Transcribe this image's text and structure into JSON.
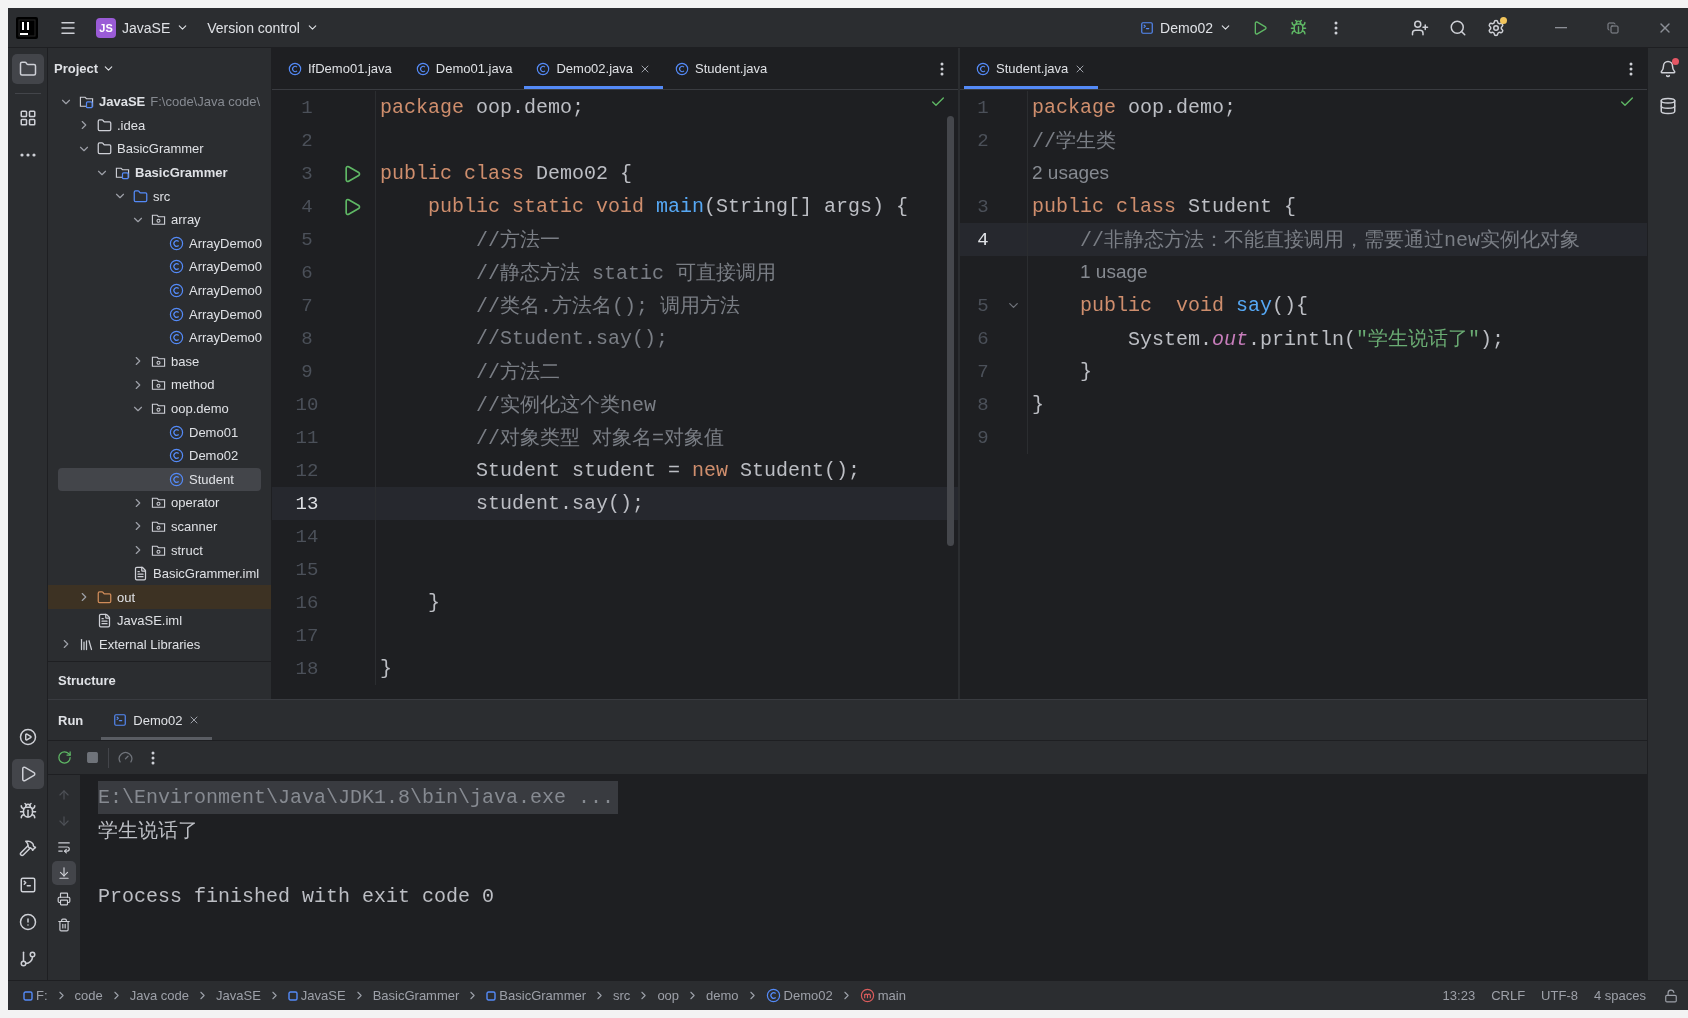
{
  "title_bar": {
    "project_badge": "JS",
    "project": "JavaSE",
    "vcs": "Version control",
    "run_config": "Demo02"
  },
  "tool_strip": {
    "top": [
      {
        "kind": "project",
        "selected": true
      },
      {
        "kind": "structure",
        "selected": false
      },
      {
        "kind": "more",
        "selected": false
      }
    ],
    "bottom": [
      {
        "kind": "services",
        "selected": false
      },
      {
        "kind": "run",
        "selected": true
      },
      {
        "kind": "debug",
        "selected": false
      },
      {
        "kind": "build",
        "selected": false
      },
      {
        "kind": "terminal",
        "selected": false
      },
      {
        "kind": "problems",
        "selected": false
      },
      {
        "kind": "git",
        "selected": false
      }
    ]
  },
  "project_panel": {
    "title": "Project",
    "structure_title": "Structure",
    "tree": [
      {
        "label": "JavaSE",
        "detail": "F:\\code\\Java code\\",
        "kind": "module",
        "expanded": true,
        "selected": false,
        "children": [
          {
            "label": ".idea",
            "kind": "folder",
            "expanded": false,
            "selected": false
          },
          {
            "label": "BasicGrammer",
            "kind": "folder",
            "expanded": true,
            "selected": false,
            "children": [
              {
                "label": "BasicGrammer",
                "kind": "module",
                "expanded": true,
                "selected": false,
                "children": [
                  {
                    "label": "src",
                    "kind": "source",
                    "expanded": true,
                    "selected": false,
                    "children": [
                      {
                        "label": "array",
                        "kind": "package",
                        "expanded": true,
                        "selected": false,
                        "children": [
                          {
                            "label": "ArrayDemo0",
                            "kind": "class",
                            "selected": false
                          },
                          {
                            "label": "ArrayDemo0",
                            "kind": "class",
                            "selected": false
                          },
                          {
                            "label": "ArrayDemo0",
                            "kind": "class",
                            "selected": false
                          },
                          {
                            "label": "ArrayDemo0",
                            "kind": "class",
                            "selected": false
                          },
                          {
                            "label": "ArrayDemo0",
                            "kind": "class",
                            "selected": false
                          }
                        ]
                      },
                      {
                        "label": "base",
                        "kind": "package",
                        "expanded": false,
                        "selected": false
                      },
                      {
                        "label": "method",
                        "kind": "package",
                        "expanded": false,
                        "selected": false
                      },
                      {
                        "label": "oop.demo",
                        "kind": "package",
                        "expanded": true,
                        "selected": false,
                        "children": [
                          {
                            "label": "Demo01",
                            "kind": "class",
                            "selected": false
                          },
                          {
                            "label": "Demo02",
                            "kind": "class",
                            "selected": false
                          },
                          {
                            "label": "Student",
                            "kind": "class",
                            "selected": true
                          }
                        ]
                      },
                      {
                        "label": "operator",
                        "kind": "package",
                        "expanded": false,
                        "selected": false
                      },
                      {
                        "label": "scanner",
                        "kind": "package",
                        "expanded": false,
                        "selected": false
                      },
                      {
                        "label": "struct",
                        "kind": "package",
                        "expanded": false,
                        "selected": false
                      }
                    ]
                  },
                  {
                    "label": "BasicGrammer.iml",
                    "kind": "file",
                    "selected": false
                  }
                ]
              }
            ]
          },
          {
            "label": "out",
            "kind": "excluded",
            "expanded": false,
            "selected": false
          },
          {
            "label": "JavaSE.iml",
            "kind": "file",
            "selected": false
          }
        ]
      },
      {
        "label": "External Libraries",
        "kind": "library",
        "expanded": false,
        "selected": false
      }
    ]
  },
  "editors": [
    {
      "tabs": [
        {
          "label": "IfDemo01.java",
          "selected": false
        },
        {
          "label": "Demo01.java",
          "selected": false
        },
        {
          "label": "Demo02.java",
          "selected": true
        },
        {
          "label": "Student.java",
          "selected": false
        }
      ],
      "lines": [
        {
          "kind": "code",
          "number": "1",
          "current": false,
          "runnable": false,
          "tokens": [
            {
              "kind": "keyword",
              "text": "package"
            },
            {
              "kind": "plain",
              "text": " oop.demo;"
            }
          ]
        },
        {
          "kind": "code",
          "number": "2",
          "current": false,
          "runnable": false
        },
        {
          "kind": "code",
          "number": "3",
          "current": false,
          "runnable": true,
          "tokens": [
            {
              "kind": "keyword",
              "text": "public class"
            },
            {
              "kind": "plain",
              "text": " Demo02 {"
            }
          ]
        },
        {
          "kind": "code",
          "number": "4",
          "current": false,
          "runnable": true,
          "tokens": [
            {
              "kind": "keyword",
              "text": "    public static void "
            },
            {
              "kind": "function",
              "text": "main"
            },
            {
              "kind": "plain",
              "text": "(String[] args) {"
            }
          ]
        },
        {
          "kind": "code",
          "number": "5",
          "current": false,
          "runnable": false,
          "tokens": [
            {
              "kind": "comment",
              "text": "        //方法一"
            }
          ]
        },
        {
          "kind": "code",
          "number": "6",
          "current": false,
          "runnable": false,
          "tokens": [
            {
              "kind": "comment",
              "text": "        //静态方法 static 可直接调用"
            }
          ]
        },
        {
          "kind": "code",
          "number": "7",
          "current": false,
          "runnable": false,
          "tokens": [
            {
              "kind": "comment",
              "text": "        //类名.方法名(); 调用方法"
            }
          ]
        },
        {
          "kind": "code",
          "number": "8",
          "current": false,
          "runnable": false,
          "tokens": [
            {
              "kind": "comment",
              "text": "        //Student.say();"
            }
          ]
        },
        {
          "kind": "code",
          "number": "9",
          "current": false,
          "runnable": false,
          "tokens": [
            {
              "kind": "comment",
              "text": "        //方法二"
            }
          ]
        },
        {
          "kind": "code",
          "number": "10",
          "current": false,
          "runnable": false,
          "tokens": [
            {
              "kind": "comment",
              "text": "        //实例化这个类new"
            }
          ]
        },
        {
          "kind": "code",
          "number": "11",
          "current": false,
          "runnable": false,
          "tokens": [
            {
              "kind": "comment",
              "text": "        //对象类型 对象名=对象值"
            }
          ]
        },
        {
          "kind": "code",
          "number": "12",
          "current": false,
          "runnable": false,
          "tokens": [
            {
              "kind": "plain",
              "text": "        Student student = "
            },
            {
              "kind": "keyword",
              "text": "new"
            },
            {
              "kind": "plain",
              "text": " Student();"
            }
          ]
        },
        {
          "kind": "code",
          "number": "13",
          "current": true,
          "runnable": false,
          "tokens": [
            {
              "kind": "plain",
              "text": "        student.say();"
            }
          ]
        },
        {
          "kind": "code",
          "number": "14",
          "current": false,
          "runnable": false
        },
        {
          "kind": "code",
          "number": "15",
          "current": false,
          "runnable": false
        },
        {
          "kind": "code",
          "number": "16",
          "current": false,
          "runnable": false,
          "tokens": [
            {
              "kind": "plain",
              "text": "    }"
            }
          ]
        },
        {
          "kind": "code",
          "number": "17",
          "current": false,
          "runnable": false
        },
        {
          "kind": "code",
          "number": "18",
          "current": false,
          "runnable": false,
          "tokens": [
            {
              "kind": "plain",
              "text": "}"
            }
          ]
        }
      ]
    },
    {
      "tabs": [
        {
          "label": "Student.java",
          "selected": true
        }
      ],
      "lines": [
        {
          "kind": "code",
          "number": "1",
          "current": false,
          "foldable": false,
          "tokens": [
            {
              "kind": "keyword",
              "text": "package"
            },
            {
              "kind": "plain",
              "text": " oop.demo;"
            }
          ]
        },
        {
          "kind": "code",
          "number": "2",
          "current": false,
          "foldable": false,
          "tokens": [
            {
              "kind": "comment",
              "text": "//学生类"
            }
          ]
        },
        {
          "kind": "hint",
          "text": "2 usages"
        },
        {
          "kind": "code",
          "number": "3",
          "current": false,
          "foldable": false,
          "tokens": [
            {
              "kind": "keyword",
              "text": "public class"
            },
            {
              "kind": "plain",
              "text": " Student {"
            }
          ]
        },
        {
          "kind": "code",
          "number": "4",
          "current": true,
          "foldable": false,
          "tokens": [
            {
              "kind": "comment",
              "text": "    //非静态方法：不能直接调用，需要通过new实例化对象"
            }
          ]
        },
        {
          "kind": "hint",
          "text": "    1 usage"
        },
        {
          "kind": "code",
          "number": "5",
          "current": false,
          "foldable": true,
          "tokens": [
            {
              "kind": "keyword",
              "text": "    public  void "
            },
            {
              "kind": "function",
              "text": "say"
            },
            {
              "kind": "plain",
              "text": "(){"
            }
          ]
        },
        {
          "kind": "code",
          "number": "6",
          "current": false,
          "foldable": false,
          "tokens": [
            {
              "kind": "plain",
              "text": "        System."
            },
            {
              "kind": "field",
              "text": "out"
            },
            {
              "kind": "plain",
              "text": ".println("
            },
            {
              "kind": "string",
              "text": "\"学生说话了\""
            },
            {
              "kind": "plain",
              "text": ");"
            }
          ]
        },
        {
          "kind": "code",
          "number": "7",
          "current": false,
          "foldable": false,
          "tokens": [
            {
              "kind": "plain",
              "text": "    }"
            }
          ]
        },
        {
          "kind": "code",
          "number": "8",
          "current": false,
          "foldable": false,
          "tokens": [
            {
              "kind": "plain",
              "text": "}"
            }
          ]
        },
        {
          "kind": "code",
          "number": "9",
          "current": false,
          "foldable": false
        }
      ]
    }
  ],
  "run_panel": {
    "title": "Run",
    "tabs": [
      {
        "label": "Demo02",
        "selected": true
      }
    ],
    "side_tools": [
      {
        "kind": "up",
        "disabled": true,
        "selected": false
      },
      {
        "kind": "down",
        "disabled": true,
        "selected": false
      },
      {
        "kind": "wrap",
        "disabled": false,
        "selected": false
      },
      {
        "kind": "scroll-end",
        "disabled": false,
        "selected": true
      },
      {
        "kind": "print",
        "disabled": false,
        "selected": false
      },
      {
        "kind": "clear",
        "disabled": false,
        "selected": false
      }
    ],
    "console": [
      {
        "kind": "command",
        "text": "E:\\Environment\\Java\\JDK1.8\\bin\\java.exe ..."
      },
      {
        "kind": "output",
        "text": "学生说话了"
      },
      {
        "kind": "exit",
        "text": "Process finished with exit code 0"
      }
    ]
  },
  "status_bar": {
    "breadcrumbs": [
      {
        "label": "F:",
        "kind": "module"
      },
      {
        "label": "code",
        "kind": "folder"
      },
      {
        "label": "Java code",
        "kind": "folder"
      },
      {
        "label": "JavaSE",
        "kind": "folder"
      },
      {
        "label": "JavaSE",
        "kind": "module"
      },
      {
        "label": "BasicGrammer",
        "kind": "folder"
      },
      {
        "label": "BasicGrammer",
        "kind": "module"
      },
      {
        "label": "src",
        "kind": "folder"
      },
      {
        "label": "oop",
        "kind": "folder"
      },
      {
        "label": "demo",
        "kind": "folder"
      },
      {
        "label": "Demo02",
        "kind": "class"
      },
      {
        "label": "main",
        "kind": "method"
      }
    ],
    "info": [
      "13:23",
      "CRLF",
      "UTF-8",
      "4 spaces"
    ]
  }
}
